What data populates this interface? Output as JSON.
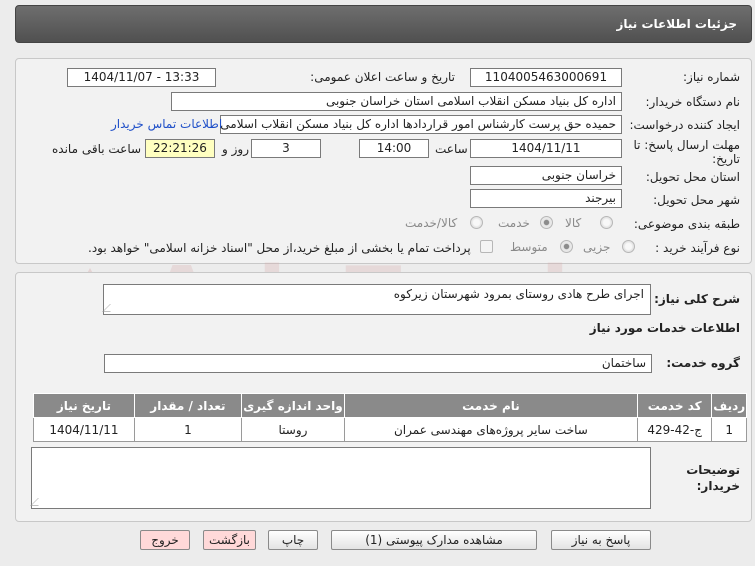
{
  "header": {
    "title": "جزئیات اطلاعات نیاز"
  },
  "watermark": {
    "text": "AriaTender.net",
    "color": "#d9a9a9"
  },
  "fields": {
    "need_number_label": "شماره نیاز:",
    "need_number": "1104005463000691",
    "announce_label": "تاریخ و ساعت اعلان عمومی:",
    "announce_value": "1404/11/07 - 13:33",
    "buyer_org_label": "نام دستگاه خریدار:",
    "buyer_org": "اداره کل بنیاد مسکن انقلاب اسلامی استان خراسان جنوبی",
    "creator_label": "ایجاد کننده درخواست:",
    "creator": "حمیده حق پرست کارشناس امور قراردادها اداره کل بنیاد مسکن انقلاب اسلامی",
    "contact_link": "اطلاعات تماس خریدار",
    "deadline_label_1": "مهلت ارسال پاسخ: تا",
    "deadline_label_2": "تاریخ:",
    "deadline_date": "1404/11/11",
    "time_label": "ساعت",
    "deadline_time": "14:00",
    "days_value": "3",
    "days_label": "روز و",
    "remaining_time": "22:21:26",
    "remaining_label": "ساعت باقی مانده",
    "province_label": "استان محل تحویل:",
    "province": "خراسان جنوبی",
    "city_label": "شهر محل تحویل:",
    "city": "بیرجند",
    "category_label": "طبقه بندی موضوعی:",
    "category_options": [
      "کالا",
      "خدمت",
      "کالا/خدمت"
    ],
    "category_selected": "خدمت",
    "purchase_label": "نوع فرآیند خرید :",
    "purchase_options": [
      "جزیی",
      "متوسط"
    ],
    "purchase_selected": "متوسط",
    "payment_note": "پرداخت تمام یا بخشی از مبلغ خرید،از محل \"اسناد خزانه اسلامی\" خواهد بود."
  },
  "summary": {
    "label": "شرح کلی نیاز:",
    "value": "اجرای طرح هادی روستای بمرود شهرستان زیرکوه"
  },
  "services": {
    "section_title": "اطلاعات خدمات مورد نیاز",
    "group_label": "گروه خدمت:",
    "group_value": "ساختمان",
    "columns": [
      "ردیف",
      "کد خدمت",
      "نام خدمت",
      "واحد اندازه گیری",
      "تعداد / مقدار",
      "تاریخ نیاز"
    ],
    "rows": [
      [
        "1",
        "ج-42-429",
        "ساخت سایر پروژه‌های مهندسی عمران",
        "روستا",
        "1",
        "1404/11/11"
      ]
    ]
  },
  "buyer_notes": {
    "label_1": "توضیحات",
    "label_2": "خریدار:",
    "value": ""
  },
  "buttons": {
    "reply": "پاسخ به نیاز",
    "attachments": "مشاهده مدارک پیوستی (1)",
    "print": "چاپ",
    "back": "بازگشت",
    "exit": "خروج"
  }
}
